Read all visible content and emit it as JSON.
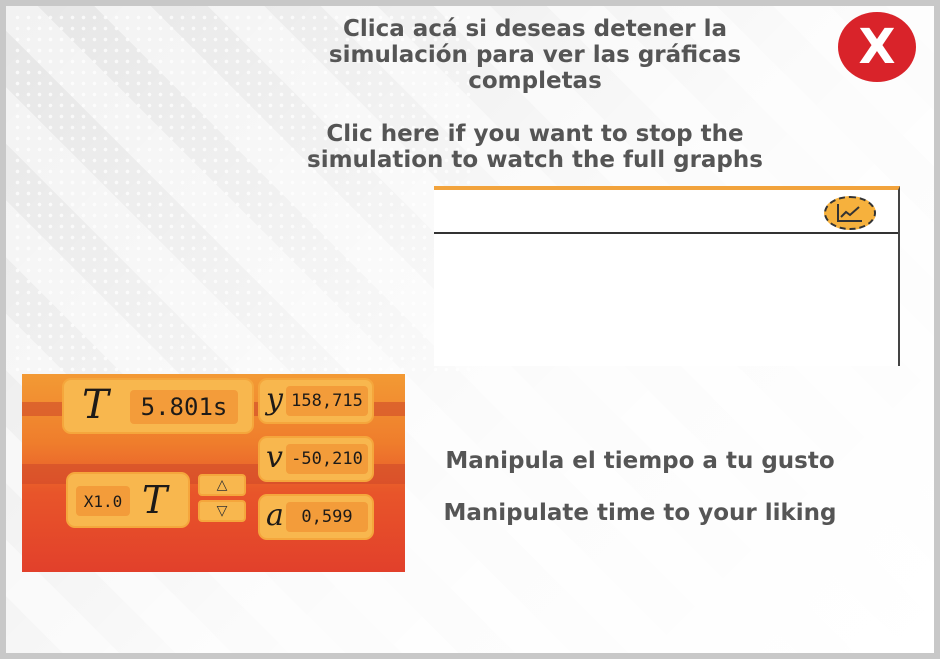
{
  "instructions": {
    "spanish": [
      "Clica acá si deseas detener la",
      "simulación para ver las gráficas",
      "completas"
    ],
    "english": [
      "Clic here if you want to stop the",
      "simulation to watch the full graphs"
    ]
  },
  "close_button": {
    "label": "X",
    "icon": "close-icon",
    "color": "#d9232a"
  },
  "graph_panel": {
    "icon": "line-chart-icon",
    "accent": "#f2a33c"
  },
  "widget": {
    "time_label": "T",
    "time_value": "5.801s",
    "speed_label": "X1.0",
    "speed_time_label": "T",
    "up_arrow": "△",
    "down_arrow": "▽",
    "y_label": "y",
    "y_value": "158,715",
    "v_label": "v",
    "v_value": "-50,210",
    "a_label": "a",
    "a_value": "0,599"
  },
  "captions": {
    "spanish": "Manipula el tiempo a tu gusto",
    "english": "Manipulate time to your liking"
  }
}
